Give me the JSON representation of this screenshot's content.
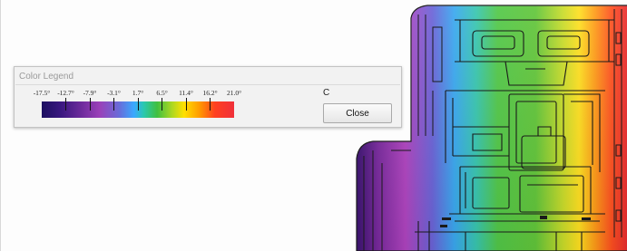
{
  "legend": {
    "title": "Color Legend",
    "unit": "C",
    "close_label": "Close",
    "ticks": [
      "-17.5°",
      "-12.7°",
      "-7.9°",
      "-3.1°",
      "1.7°",
      "6.5°",
      "11.4°",
      "16.2°",
      "21.0°"
    ]
  },
  "colors": {
    "window_bg": "#f2f2f2",
    "cold": "#1c1060",
    "hot": "#f0303a"
  }
}
